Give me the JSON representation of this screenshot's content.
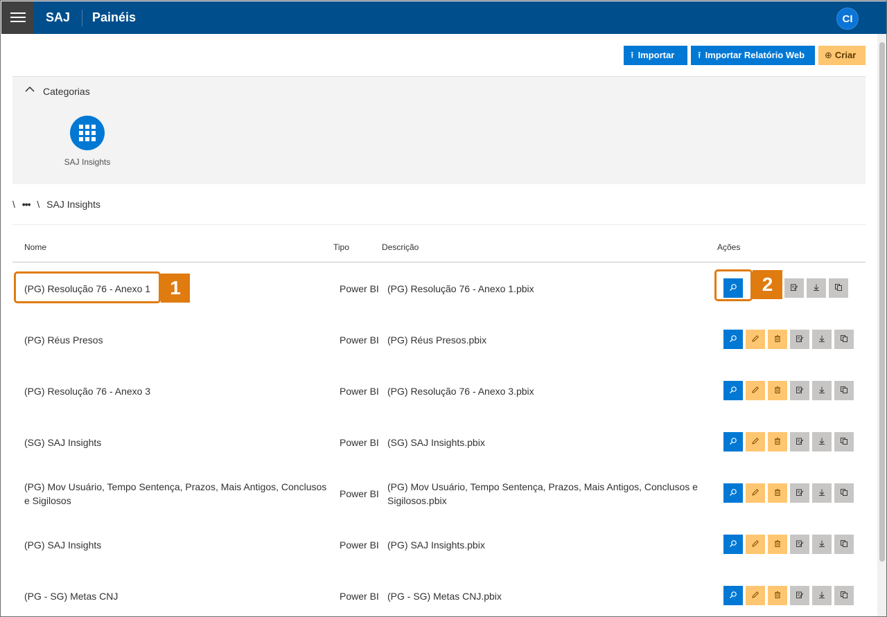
{
  "header": {
    "app_name": "SAJ",
    "page_title": "Painéis",
    "user_initials": "CI"
  },
  "toolbar": {
    "import_label": "Importar",
    "import_web_label": "Importar Relatório Web",
    "create_label": "Criar"
  },
  "categories": {
    "title": "Categorias",
    "items": [
      {
        "label": "SAJ Insights"
      }
    ]
  },
  "breadcrumb": {
    "sep": "\\",
    "more": "•••",
    "current": "SAJ Insights"
  },
  "table": {
    "headers": {
      "name": "Nome",
      "type": "Tipo",
      "description": "Descrição",
      "actions": "Ações"
    },
    "rows": [
      {
        "name": "(PG) Resolução 76 - Anexo 1",
        "type": "Power BI",
        "description": "(PG) Resolução 76 - Anexo 1.pbix"
      },
      {
        "name": "(PG) Réus Presos",
        "type": "Power BI",
        "description": "(PG) Réus Presos.pbix"
      },
      {
        "name": "(PG) Resolução 76 - Anexo 3",
        "type": "Power BI",
        "description": "(PG) Resolução 76 - Anexo 3.pbix"
      },
      {
        "name": "(SG) SAJ Insights",
        "type": "Power BI",
        "description": "(SG) SAJ Insights.pbix"
      },
      {
        "name": "(PG) Mov Usuário, Tempo Sentença, Prazos, Mais Antigos, Conclusos e Sigilosos",
        "type": "Power BI",
        "description": "(PG) Mov Usuário, Tempo Sentença, Prazos, Mais Antigos, Conclusos e Sigilosos.pbix"
      },
      {
        "name": "(PG) SAJ Insights",
        "type": "Power BI",
        "description": "(PG) SAJ Insights.pbix"
      },
      {
        "name": "(PG - SG) Metas CNJ",
        "type": "Power BI",
        "description": "(PG - SG) Metas CNJ.pbix"
      }
    ]
  },
  "annotations": {
    "step1": "1",
    "step2": "2"
  },
  "colors": {
    "header_bg": "#004e8c",
    "primary": "#0078d4",
    "warning": "#ffc671",
    "annotation": "#e07b10"
  }
}
